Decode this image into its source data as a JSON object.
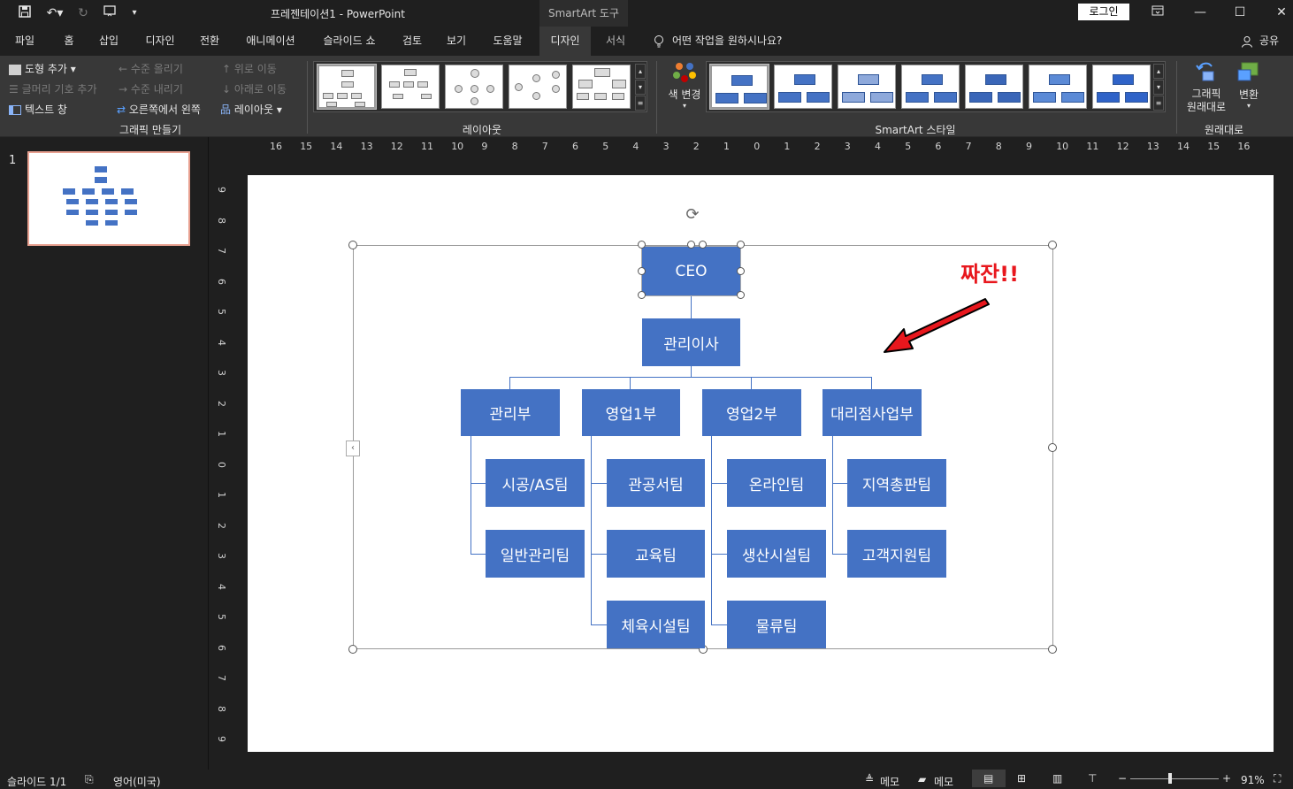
{
  "titlebar": {
    "title": "프레젠테이션1  -  PowerPoint",
    "context_title": "SmartArt 도구",
    "login": "로그인"
  },
  "tabs": [
    "파일",
    "홈",
    "삽입",
    "디자인",
    "전환",
    "애니메이션",
    "슬라이드 쇼",
    "검토",
    "보기",
    "도움말",
    "디자인",
    "서식"
  ],
  "tell_me": "어떤 작업을 원하시나요?",
  "share": "공유",
  "ribbon": {
    "create_graphic": {
      "add_shape": "도형 추가",
      "add_bullet": "글머리 기호 추가",
      "text_pane": "텍스트 창",
      "promote": "수준 올리기",
      "demote": "수준 내리기",
      "right_to_left": "오른쪽에서 왼쪽",
      "move_up": "위로 이동",
      "move_down": "아래로 이동",
      "layout": "레이아웃",
      "label": "그래픽 만들기"
    },
    "layouts_label": "레이아웃",
    "change_colors": "색 변경",
    "styles_label": "SmartArt 스타일",
    "reset_graphic": "그래픽 원래대로",
    "convert": "변환",
    "reset_label": "원래대로"
  },
  "slide_panel": {
    "number": "1"
  },
  "ruler_h": [
    "16",
    "15",
    "14",
    "13",
    "12",
    "11",
    "10",
    "9",
    "8",
    "7",
    "6",
    "5",
    "4",
    "3",
    "2",
    "1",
    "0",
    "1",
    "2",
    "3",
    "4",
    "5",
    "6",
    "7",
    "8",
    "9",
    "10",
    "11",
    "12",
    "13",
    "14",
    "15",
    "16"
  ],
  "ruler_v": [
    "9",
    "8",
    "7",
    "6",
    "5",
    "4",
    "3",
    "2",
    "1",
    "0",
    "1",
    "2",
    "3",
    "4",
    "5",
    "6",
    "7",
    "8",
    "9"
  ],
  "org": {
    "ceo": "CEO",
    "director": "관리이사",
    "departments": [
      "관리부",
      "영업1부",
      "영업2부",
      "대리점사업부"
    ],
    "teams": {
      "d1": [
        "시공/AS팀",
        "일반관리팀"
      ],
      "d2": [
        "관공서팀",
        "교육팀",
        "체육시설팀"
      ],
      "d3": [
        "온라인팀",
        "생산시설팀",
        "물류팀"
      ],
      "d4": [
        "지역총판팀",
        "고객지원팀"
      ]
    }
  },
  "annotation": "짜잔!!",
  "status": {
    "slide": "슬라이드 1/1",
    "lang": "영어(미국)",
    "notes": "메모",
    "comments": "메모",
    "zoom": "91%"
  }
}
